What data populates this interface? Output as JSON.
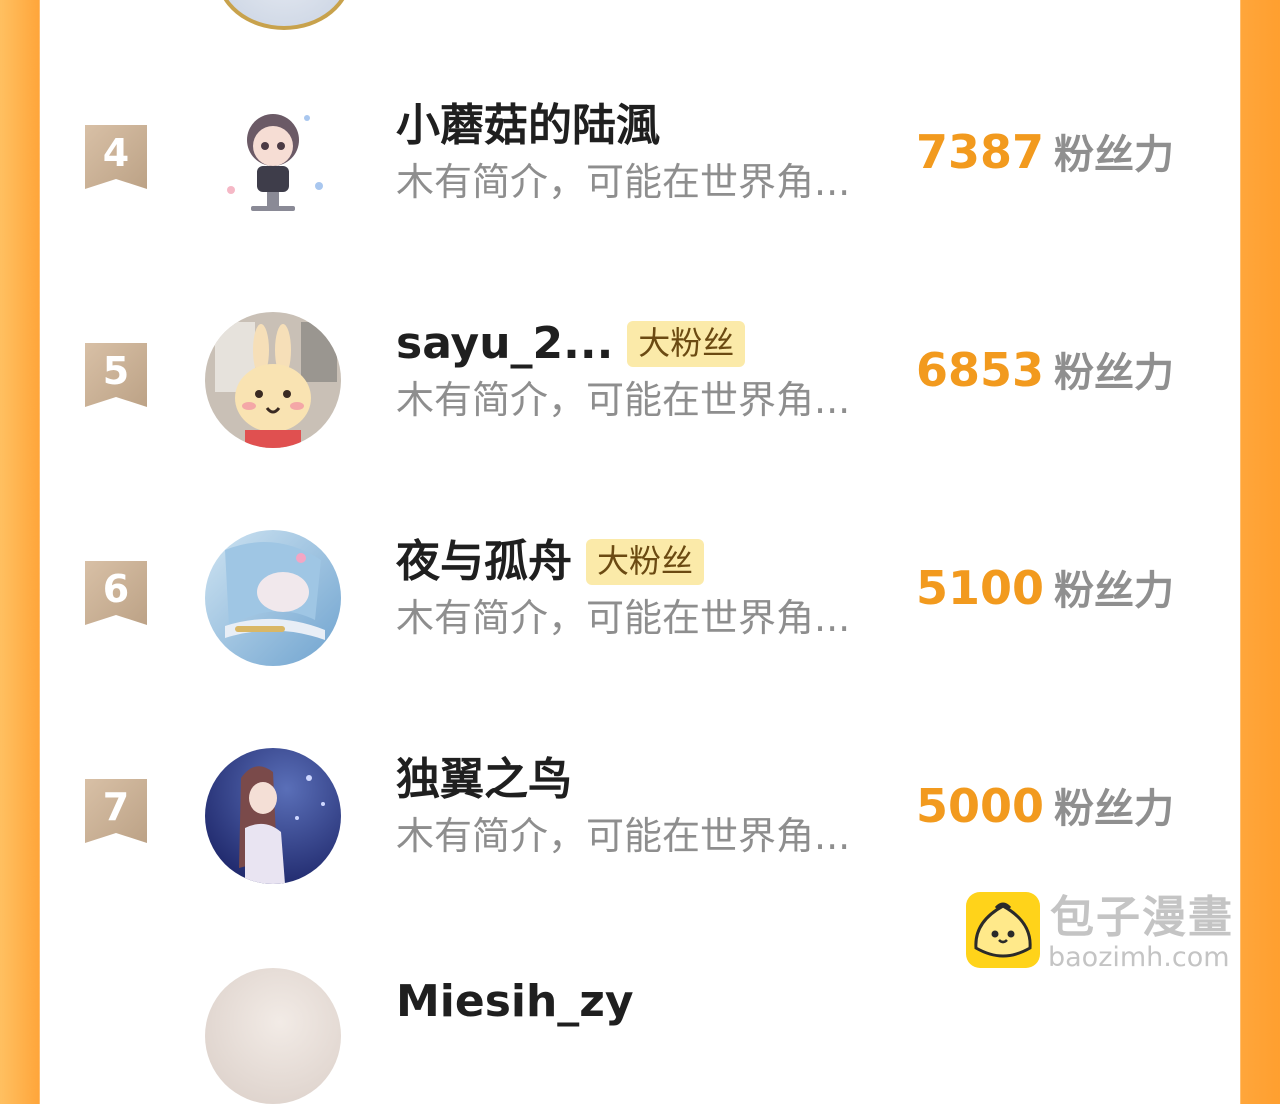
{
  "ranking": {
    "fan_unit": "粉丝力",
    "rows": [
      {
        "rank": "4",
        "name": "小蘑菇的陆渢",
        "badge": "",
        "intro": "木有简介，可能在世界角...",
        "fans": "7387",
        "avatar_icon": "chibi-avatar-icon"
      },
      {
        "rank": "5",
        "name": "sayu_2...",
        "badge": "大粉丝",
        "intro": "木有简介，可能在世界角...",
        "fans": "6853",
        "avatar_icon": "bunny-avatar-icon"
      },
      {
        "rank": "6",
        "name": "夜与孤舟",
        "badge": "大粉丝",
        "intro": "木有简介，可能在世界角...",
        "fans": "5100",
        "avatar_icon": "anime-girl-avatar-icon"
      },
      {
        "rank": "7",
        "name": "独翼之鸟",
        "badge": "",
        "intro": "木有简介，可能在世界角...",
        "fans": "5000",
        "avatar_icon": "anime-elf-avatar-icon"
      }
    ],
    "partial_next_name": "Miesih_zy"
  },
  "watermark": {
    "title": "包子漫畫",
    "url": "baozimh.com",
    "logo_icon": "bun-logo-icon"
  },
  "colors": {
    "frame_orange": "#ffa53a",
    "fans_count": "#f29a1e",
    "rank_badge": "#c8ac8f",
    "fan_badge_bg": "#fbeaa9"
  }
}
